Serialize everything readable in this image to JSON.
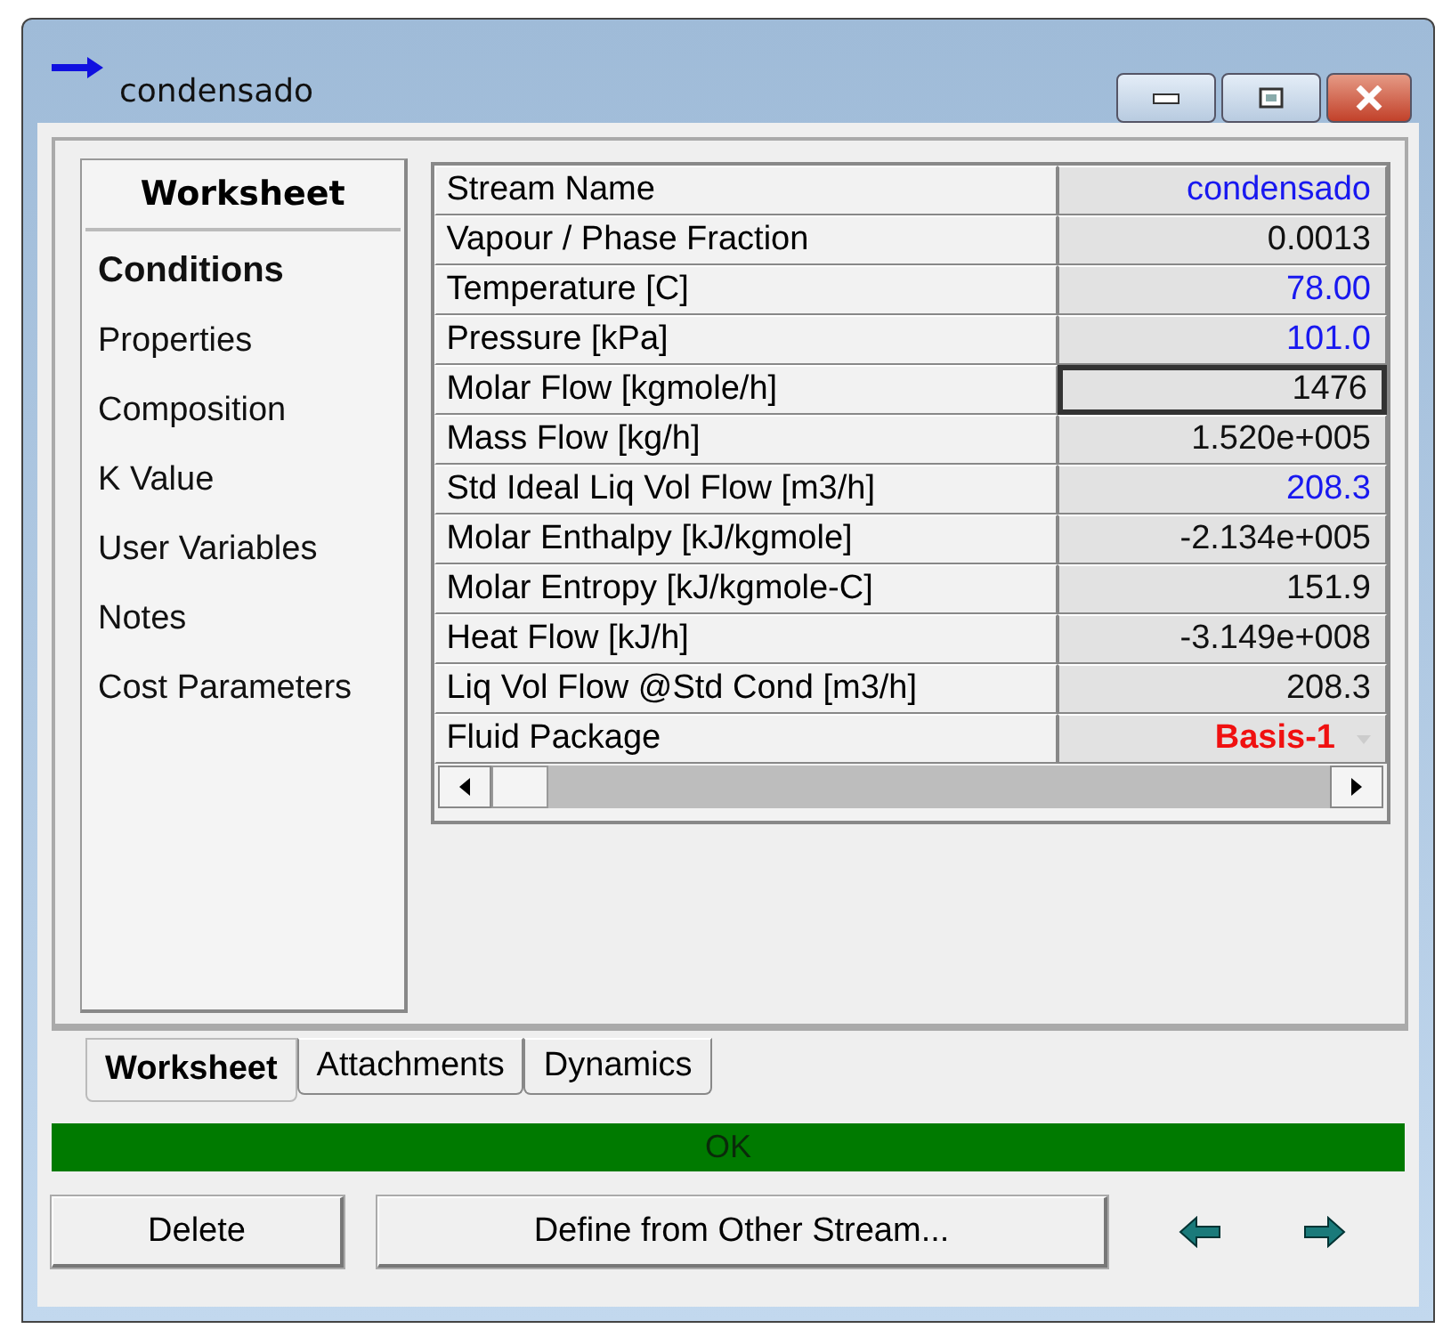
{
  "window": {
    "title": "condensado"
  },
  "sidebar": {
    "heading": "Worksheet",
    "items": [
      {
        "label": "Conditions",
        "selected": true
      },
      {
        "label": "Properties",
        "selected": false
      },
      {
        "label": "Composition",
        "selected": false
      },
      {
        "label": "K Value",
        "selected": false
      },
      {
        "label": "User Variables",
        "selected": false
      },
      {
        "label": "Notes",
        "selected": false
      },
      {
        "label": "Cost Parameters",
        "selected": false
      }
    ]
  },
  "table": {
    "rows": [
      {
        "label": "Stream Name",
        "value": "condensado",
        "kind": "specified",
        "selected": false
      },
      {
        "label": "Vapour / Phase Fraction",
        "value": "0.0013",
        "kind": "calculated",
        "selected": false
      },
      {
        "label": "Temperature [C]",
        "value": "78.00",
        "kind": "specified",
        "selected": false
      },
      {
        "label": "Pressure [kPa]",
        "value": "101.0",
        "kind": "specified",
        "selected": false
      },
      {
        "label": "Molar Flow [kgmole/h]",
        "value": "1476",
        "kind": "calculated",
        "selected": true
      },
      {
        "label": "Mass Flow [kg/h]",
        "value": "1.520e+005",
        "kind": "calculated",
        "selected": false
      },
      {
        "label": "Std Ideal Liq Vol Flow [m3/h]",
        "value": "208.3",
        "kind": "specified",
        "selected": false
      },
      {
        "label": "Molar Enthalpy [kJ/kgmole]",
        "value": "-2.134e+005",
        "kind": "calculated",
        "selected": false
      },
      {
        "label": "Molar Entropy [kJ/kgmole-C]",
        "value": "151.9",
        "kind": "calculated",
        "selected": false
      },
      {
        "label": "Heat Flow [kJ/h]",
        "value": "-3.149e+008",
        "kind": "calculated",
        "selected": false
      },
      {
        "label": "Liq Vol Flow @Std Cond [m3/h]",
        "value": "208.3",
        "kind": "calculated",
        "selected": false
      },
      {
        "label": "Fluid Package",
        "value": "Basis-1",
        "kind": "package",
        "selected": false
      }
    ]
  },
  "tabs": [
    {
      "label": "Worksheet",
      "selected": true
    },
    {
      "label": "Attachments",
      "selected": false
    },
    {
      "label": "Dynamics",
      "selected": false
    }
  ],
  "status_bar": {
    "text": "OK"
  },
  "buttons": [
    "Delete",
    "Define from Other Stream..."
  ]
}
